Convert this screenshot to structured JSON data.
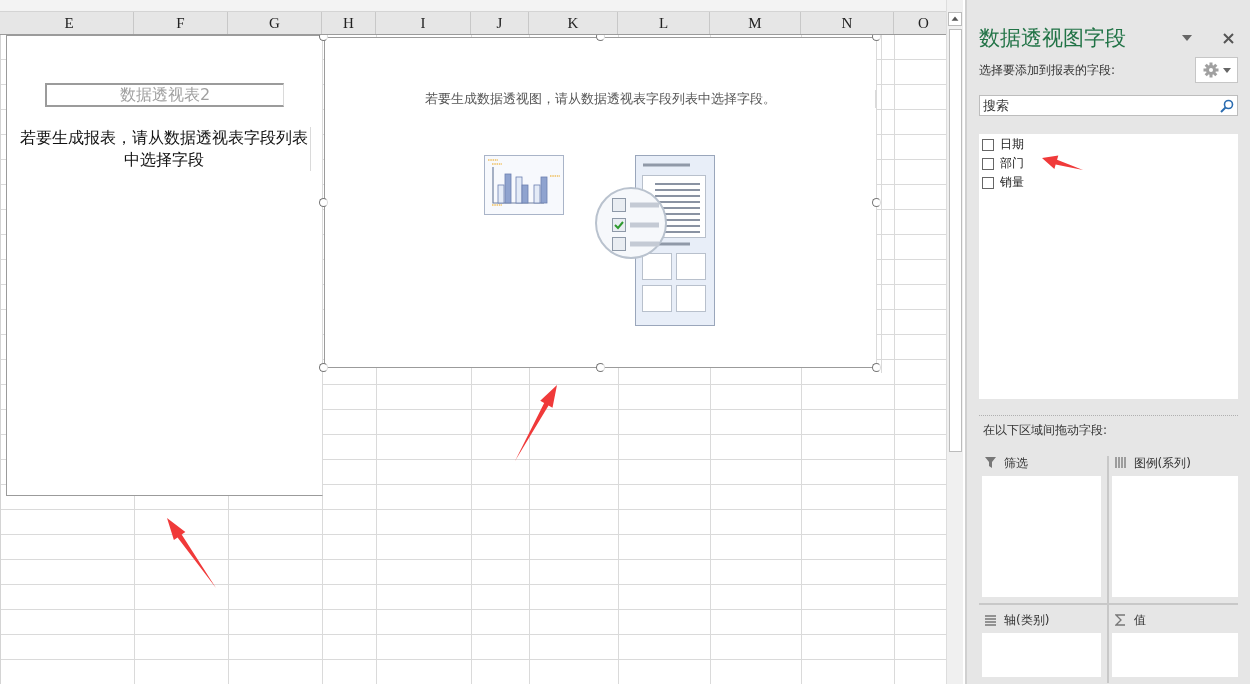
{
  "columns": [
    "E",
    "F",
    "G",
    "H",
    "I",
    "J",
    "K",
    "L",
    "M",
    "N",
    "O"
  ],
  "pivot_table": {
    "name": "数据透视表2",
    "message": "若要生成报表，请从数据透视表字段列表中选择字段"
  },
  "pivot_chart": {
    "message": "若要生成数据透视图，请从数据透视表字段列表中选择字段。"
  },
  "field_panel": {
    "title": "数据透视图字段",
    "subtitle": "选择要添加到报表的字段:",
    "search": {
      "placeholder": "搜索"
    },
    "fields": [
      {
        "label": "日期",
        "checked": false
      },
      {
        "label": "部门",
        "checked": false
      },
      {
        "label": "销量",
        "checked": false
      }
    ],
    "areas_label": "在以下区域间拖动字段:",
    "areas": [
      {
        "kind": "filter",
        "label": "筛选"
      },
      {
        "kind": "legend",
        "label": "图例(系列)"
      },
      {
        "kind": "axis",
        "label": "轴(类别)"
      },
      {
        "kind": "values",
        "label": "值"
      }
    ]
  }
}
